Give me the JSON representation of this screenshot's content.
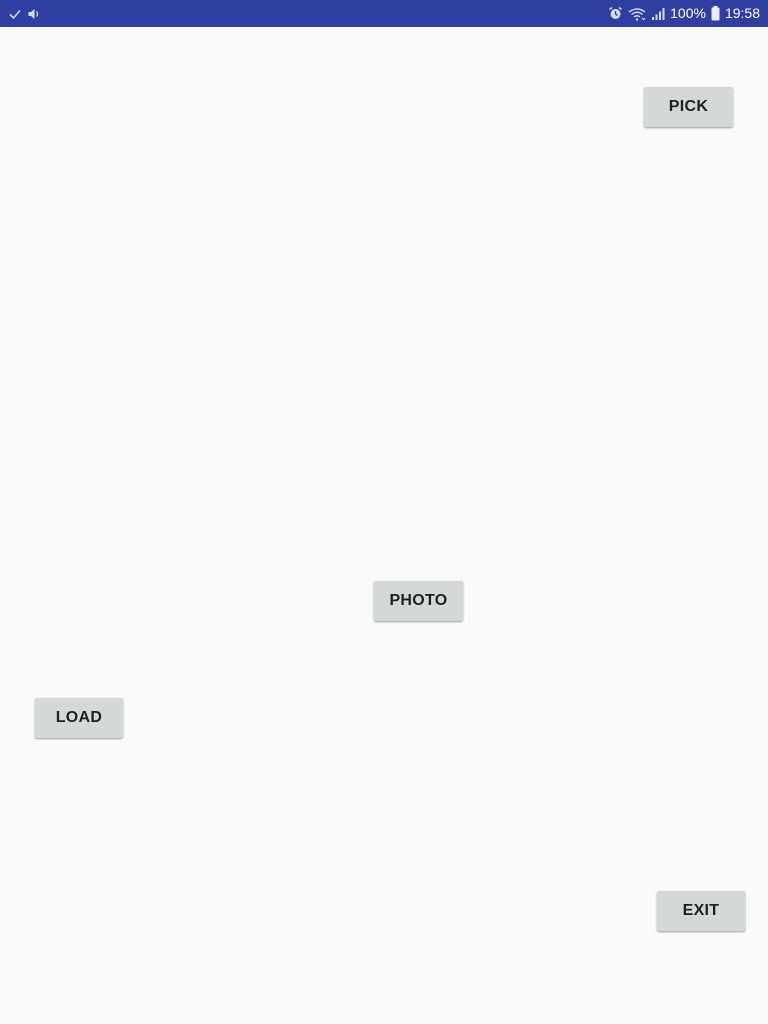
{
  "status_bar": {
    "left_icons": [
      "check-icon",
      "volume-icon"
    ],
    "right_icons": [
      "alarm-icon",
      "wifi-icon",
      "signal-icon",
      "battery-icon"
    ],
    "battery_text": "100%",
    "time": "19:58",
    "background_color": "#303f9f"
  },
  "buttons": {
    "pick_label": "PICK",
    "photo_label": "PHOTO",
    "load_label": "LOAD",
    "exit_label": "EXIT"
  },
  "colors": {
    "background": "#fafafa",
    "button_background": "#d6d7d7",
    "button_text": "#212121"
  }
}
